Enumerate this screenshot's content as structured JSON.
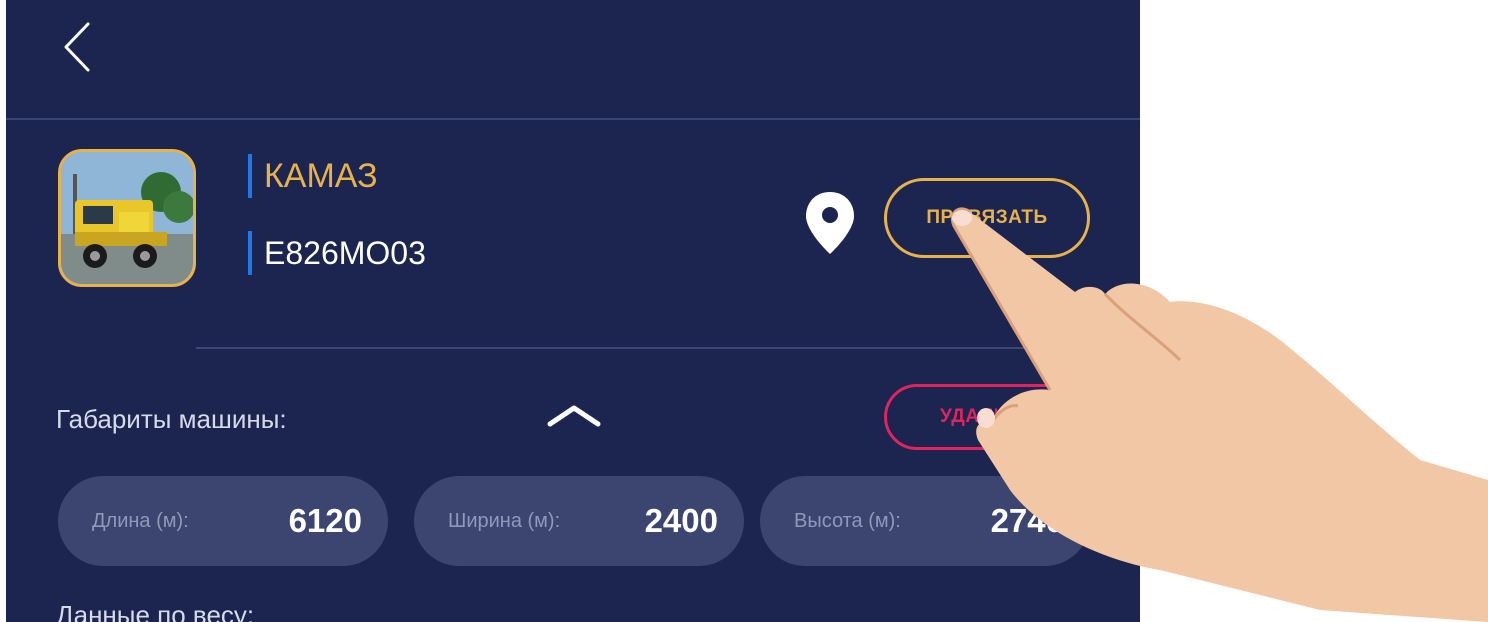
{
  "header": {
    "back_icon": "chevron-left-icon"
  },
  "vehicle": {
    "name": "КАМАЗ",
    "plate": "Е826МО03"
  },
  "location_icon": "map-pin-icon",
  "buttons": {
    "attach": "ПРИВЯЗАТЬ",
    "delete": "УДАЛИТЬ"
  },
  "dimensions": {
    "title": "Габариты машины:",
    "collapse_icon": "chevron-up-icon",
    "fields": [
      {
        "label": "Длина (м):",
        "value": "6120"
      },
      {
        "label": "Ширина (м):",
        "value": "2400"
      },
      {
        "label": "Высота (м):",
        "value": "2740"
      }
    ]
  },
  "weight": {
    "title": "Данные по весу:"
  },
  "colors": {
    "background": "#1c2550",
    "accent": "#e8b24b",
    "danger": "#e0245e",
    "marker": "#1f78e6"
  }
}
